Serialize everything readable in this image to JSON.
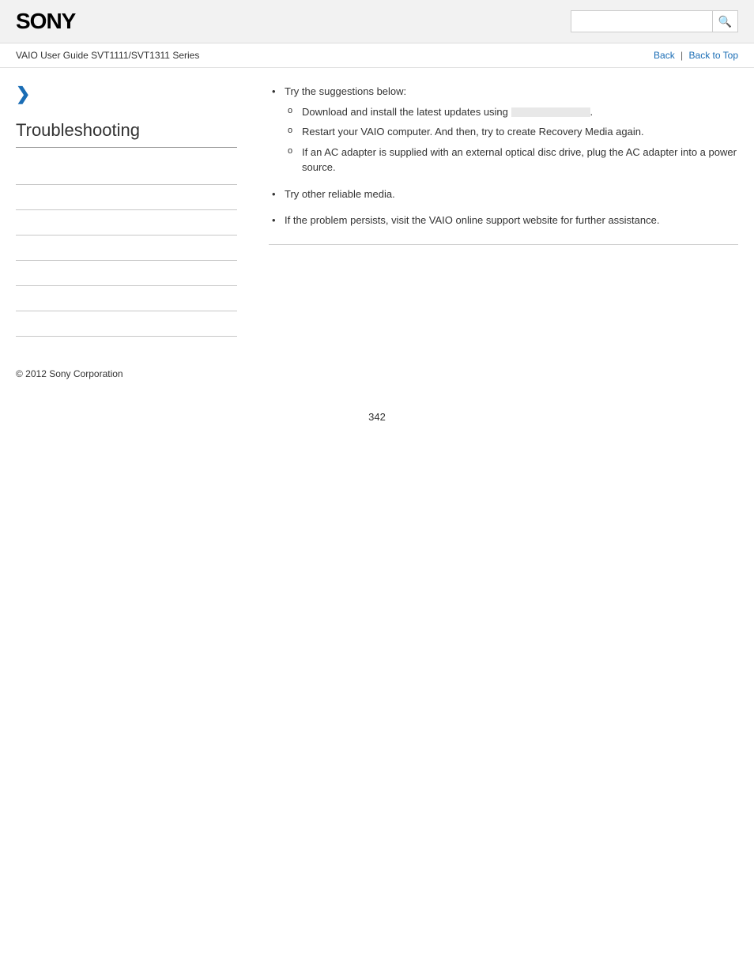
{
  "header": {
    "logo": "SONY",
    "search_placeholder": "",
    "search_icon": "🔍"
  },
  "sub_header": {
    "guide_title": "VAIO User Guide SVT1111/SVT1311 Series",
    "nav": {
      "back_label": "Back",
      "separator": "|",
      "back_to_top_label": "Back to Top"
    }
  },
  "sidebar": {
    "chevron": "❯",
    "title": "Troubleshooting",
    "nav_items": [
      {
        "label": ""
      },
      {
        "label": ""
      },
      {
        "label": ""
      },
      {
        "label": ""
      },
      {
        "label": ""
      },
      {
        "label": ""
      },
      {
        "label": ""
      }
    ]
  },
  "content": {
    "bullet1": "Try the suggestions below:",
    "sub_bullets": [
      "Download and install the latest updates using                .",
      "Restart your VAIO computer. And then, try to create Recovery Media again.",
      "If an AC adapter is supplied with an external optical disc drive, plug the AC adapter into a power source."
    ],
    "bullet2": "Try other reliable media.",
    "bullet3": "If the problem persists, visit the VAIO online support website for further assistance."
  },
  "footer": {
    "copyright": "© 2012 Sony Corporation"
  },
  "page_number": "342"
}
